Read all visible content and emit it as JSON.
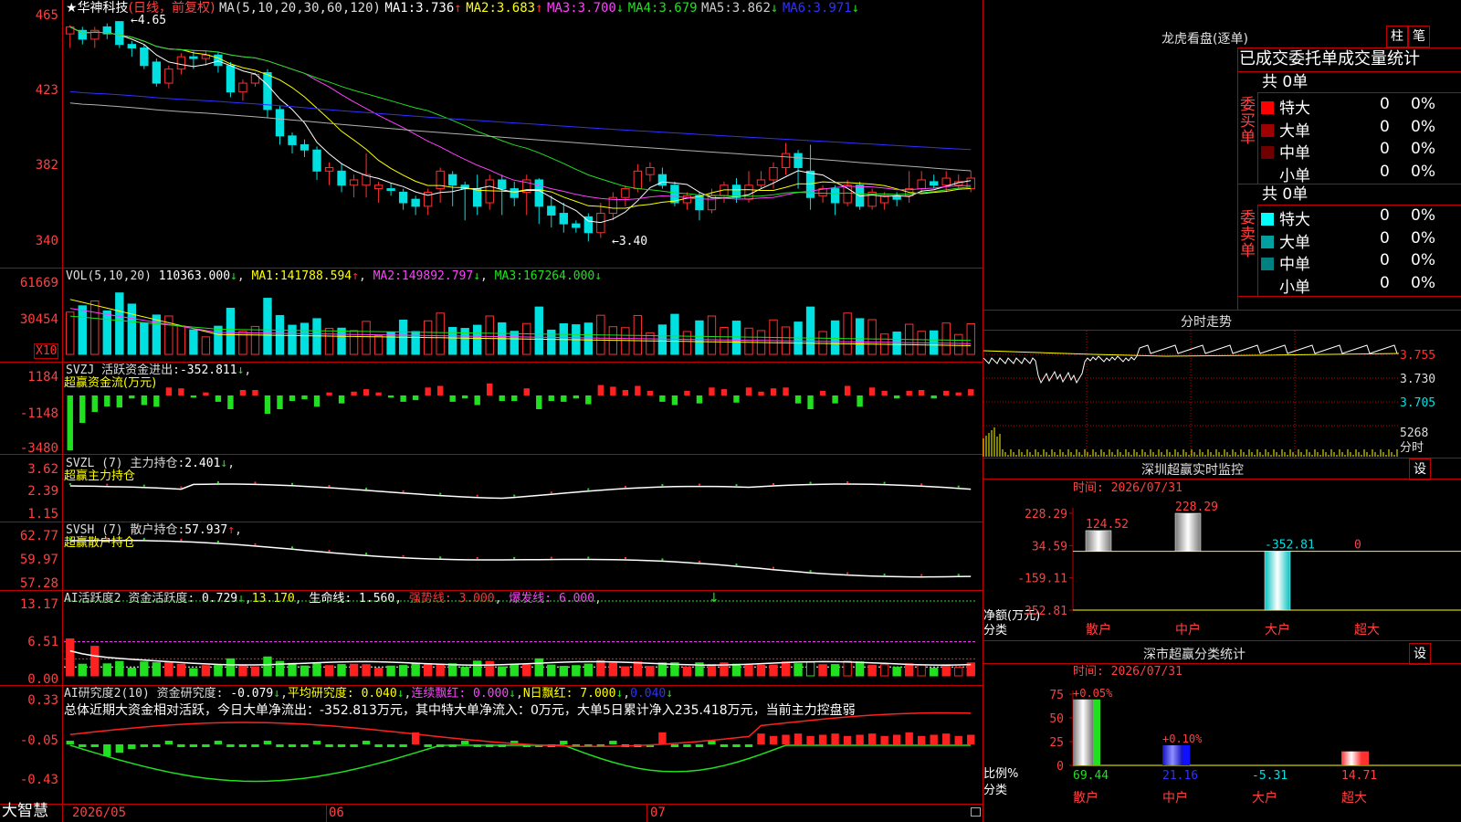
{
  "app": {
    "brand": "大智慧"
  },
  "colors": {
    "up": "#ff3030",
    "down": "#00e0e0",
    "vol_down": "#00e0e0",
    "flow_up": "#ff2020",
    "flow_down": "#20e020",
    "ma1": "#ffffff",
    "ma2": "#ffff00",
    "ma3": "#ff40ff",
    "ma4": "#20e020",
    "ma5": "#b0b0b0",
    "ma6": "#3030ff",
    "grid": "#c00000"
  },
  "main": {
    "star": "★",
    "name": "华神科技",
    "period": "(日线，前复权)",
    "ma_head": "MA(5,10,20,30,60,120)",
    "ma": [
      {
        "label": "MA1:",
        "value": "3.736",
        "arrow": "↑"
      },
      {
        "label": "MA2:",
        "value": "3.683",
        "arrow": "↑"
      },
      {
        "label": "MA3:",
        "value": "3.700",
        "arrow": "↓"
      },
      {
        "label": "MA4:",
        "value": "3.679",
        "arrow": ""
      },
      {
        "label": "MA5:",
        "value": "3.862",
        "arrow": "↓"
      },
      {
        "label": "MA6:",
        "value": "3.971",
        "arrow": "↓"
      }
    ],
    "y_labels": [
      "465",
      "423",
      "382",
      "340"
    ],
    "hi_mark": "4.65",
    "lo_mark": "←3.40",
    "candles": [
      [
        4.58,
        4.62,
        4.5,
        4.63
      ],
      [
        4.6,
        4.55,
        4.52,
        4.62
      ],
      [
        4.55,
        4.6,
        4.5,
        4.62
      ],
      [
        4.62,
        4.58,
        4.55,
        4.64
      ],
      [
        4.65,
        4.52,
        4.5,
        4.65
      ],
      [
        4.52,
        4.5,
        4.45,
        4.54
      ],
      [
        4.5,
        4.4,
        4.38,
        4.52
      ],
      [
        4.42,
        4.3,
        4.28,
        4.44
      ],
      [
        4.3,
        4.38,
        4.27,
        4.4
      ],
      [
        4.38,
        4.45,
        4.35,
        4.47
      ],
      [
        4.45,
        4.44,
        4.38,
        4.48
      ],
      [
        4.44,
        4.46,
        4.4,
        4.48
      ],
      [
        4.46,
        4.4,
        4.36,
        4.48
      ],
      [
        4.4,
        4.25,
        4.22,
        4.42
      ],
      [
        4.25,
        4.3,
        4.2,
        4.32
      ],
      [
        4.3,
        4.35,
        4.28,
        4.36
      ],
      [
        4.36,
        4.15,
        4.1,
        4.38
      ],
      [
        4.15,
        4.0,
        3.95,
        4.17
      ],
      [
        4.0,
        3.95,
        3.9,
        4.02
      ],
      [
        3.95,
        3.92,
        3.88,
        3.98
      ],
      [
        3.92,
        3.8,
        3.75,
        3.94
      ],
      [
        3.8,
        3.82,
        3.72,
        3.85
      ],
      [
        3.8,
        3.72,
        3.68,
        3.84
      ],
      [
        3.72,
        3.75,
        3.65,
        3.78
      ],
      [
        3.72,
        3.78,
        3.65,
        3.9
      ],
      [
        3.7,
        3.72,
        3.62,
        3.74
      ],
      [
        3.7,
        3.69,
        3.66,
        3.73
      ],
      [
        3.68,
        3.62,
        3.58,
        3.7
      ],
      [
        3.64,
        3.6,
        3.55,
        3.66
      ],
      [
        3.6,
        3.68,
        3.55,
        3.7
      ],
      [
        3.7,
        3.8,
        3.62,
        3.82
      ],
      [
        3.78,
        3.72,
        3.6,
        3.8
      ],
      [
        3.72,
        3.7,
        3.52,
        3.74
      ],
      [
        3.7,
        3.6,
        3.55,
        3.78
      ],
      [
        3.62,
        3.75,
        3.58,
        3.78
      ],
      [
        3.75,
        3.7,
        3.55,
        3.78
      ],
      [
        3.7,
        3.65,
        3.6,
        3.74
      ],
      [
        3.68,
        3.75,
        3.55,
        3.78
      ],
      [
        3.75,
        3.6,
        3.5,
        3.76
      ],
      [
        3.6,
        3.55,
        3.48,
        3.66
      ],
      [
        3.56,
        3.5,
        3.45,
        3.62
      ],
      [
        3.5,
        3.48,
        3.45,
        3.52
      ],
      [
        3.54,
        3.45,
        3.4,
        3.56
      ],
      [
        3.45,
        3.56,
        3.42,
        3.62
      ],
      [
        3.56,
        3.65,
        3.52,
        3.68
      ],
      [
        3.65,
        3.7,
        3.6,
        3.72
      ],
      [
        3.7,
        3.8,
        3.68,
        3.84
      ],
      [
        3.78,
        3.82,
        3.74,
        3.85
      ],
      [
        3.78,
        3.72,
        3.7,
        3.82
      ],
      [
        3.72,
        3.62,
        3.6,
        3.74
      ],
      [
        3.62,
        3.66,
        3.58,
        3.68
      ],
      [
        3.66,
        3.58,
        3.52,
        3.68
      ],
      [
        3.58,
        3.66,
        3.56,
        3.7
      ],
      [
        3.66,
        3.72,
        3.62,
        3.74
      ],
      [
        3.72,
        3.65,
        3.62,
        3.76
      ],
      [
        3.64,
        3.72,
        3.62,
        3.8
      ],
      [
        3.72,
        3.75,
        3.7,
        3.8
      ],
      [
        3.75,
        3.82,
        3.7,
        3.85
      ],
      [
        3.82,
        3.9,
        3.78,
        3.96
      ],
      [
        3.9,
        3.82,
        3.7,
        3.92
      ],
      [
        3.8,
        3.65,
        3.58,
        3.95
      ],
      [
        3.66,
        3.7,
        3.62,
        3.72
      ],
      [
        3.7,
        3.62,
        3.55,
        3.72
      ],
      [
        3.62,
        3.72,
        3.6,
        3.75
      ],
      [
        3.72,
        3.6,
        3.58,
        3.74
      ],
      [
        3.6,
        3.68,
        3.58,
        3.7
      ],
      [
        3.62,
        3.66,
        3.58,
        3.68
      ],
      [
        3.66,
        3.64,
        3.6,
        3.68
      ],
      [
        3.66,
        3.7,
        3.62,
        3.8
      ],
      [
        3.7,
        3.75,
        3.68,
        3.8
      ],
      [
        3.74,
        3.72,
        3.7,
        3.78
      ],
      [
        3.72,
        3.76,
        3.68,
        3.8
      ],
      [
        3.72,
        3.74,
        3.7,
        3.78
      ],
      [
        3.7,
        3.76,
        3.68,
        3.8
      ]
    ]
  },
  "vol": {
    "head": "VOL(5,10,20)",
    "value": "110363.000",
    "arrow": "↓",
    "ma": [
      {
        "label": "MA1:",
        "value": "141788.594",
        "arrow": "↑"
      },
      {
        "label": "MA2:",
        "value": "149892.797",
        "arrow": "↓"
      },
      {
        "label": "MA3:",
        "value": "167264.000",
        "arrow": "↓"
      }
    ],
    "y_labels": [
      "61669",
      "30454"
    ],
    "unit": "X10"
  },
  "svzj": {
    "head": "SVZJ",
    "label": "活跃资金进出:",
    "value": "-352.811",
    "arrow": "↓",
    "sub": "超赢资金流(万元)",
    "y_labels": [
      "1184",
      "-1148",
      "-3480"
    ]
  },
  "svzl": {
    "head": "SVZL (7)",
    "label": "主力持仓:",
    "value": "2.401",
    "arrow": "↓",
    "sub": "超赢主力持仓",
    "y_labels": [
      "3.62",
      "2.39",
      "1.15"
    ]
  },
  "svsh": {
    "head": "SVSH (7)",
    "label": "散户持仓:",
    "value": "57.937",
    "arrow": "↑",
    "sub": "超赢散户持仓",
    "y_labels": [
      "62.77",
      "59.97",
      "57.28"
    ]
  },
  "ai_active": {
    "head": "AI活跃度2",
    "label": "资金活跃度:",
    "value": "0.729",
    "arrow": "↓",
    "v2": "13.170",
    "life_label": "生命线:",
    "life": "1.560",
    "strong_label": "强势线:",
    "strong": "3.000",
    "burst_label": "爆发线:",
    "burst": "6.000",
    "down_mark": "↓",
    "y_labels": [
      "13.17",
      "6.51",
      "0.00"
    ]
  },
  "ai_research": {
    "head": "AI研究度2(10)",
    "label": "资金研究度:",
    "value": "-0.079",
    "arrow": "↓",
    "avg_label": "平均研究度:",
    "avg": "0.040",
    "avg_arrow": "↓",
    "cont_label": "连续飘红:",
    "cont": "0.000",
    "cont_arrow": "↓",
    "n_label": "N日飘红:",
    "n": "7.000",
    "n_arrow": "↓",
    "n2": "0.040",
    "n2_arrow": "↓",
    "summary": "总体近期大资金相对活跃，今日大单净流出：-352.813万元，其中特大单净流入：0万元，大单5日累计净入235.418万元，当前主力控盘弱",
    "y_labels": [
      "0.33",
      "-0.05",
      "-0.43"
    ]
  },
  "xaxis": {
    "labels": [
      "2026/05",
      "06",
      "07"
    ]
  },
  "dragon": {
    "title": "龙虎看盘(逐单)",
    "btn_bar": "柱",
    "btn_pen": "笔",
    "header": "已成交委托单成交量统计",
    "buy": {
      "total": "共 0单",
      "side": "委买单",
      "rows": [
        {
          "name": "特大",
          "v": "0",
          "p": "0%",
          "c": "#ff0000"
        },
        {
          "name": "大单",
          "v": "0",
          "p": "0%",
          "c": "#a00000"
        },
        {
          "name": "中单",
          "v": "0",
          "p": "0%",
          "c": "#700000"
        },
        {
          "name": "小单",
          "v": "0",
          "p": "0%",
          "c": "#000000"
        }
      ]
    },
    "sell": {
      "total": "共 0单",
      "side": "委卖单",
      "rows": [
        {
          "name": "特大",
          "v": "0",
          "p": "0%",
          "c": "#00ffff"
        },
        {
          "name": "大单",
          "v": "0",
          "p": "0%",
          "c": "#00a0a0"
        },
        {
          "name": "中单",
          "v": "0",
          "p": "0%",
          "c": "#008080"
        },
        {
          "name": "小单",
          "v": "0",
          "p": "0%",
          "c": "#000000"
        }
      ]
    }
  },
  "intraday": {
    "title": "分时走势",
    "y_labels": [
      "3.755",
      "3.730",
      "3.705"
    ],
    "vol_label": "5268",
    "vol_unit": "分时"
  },
  "sz_monitor": {
    "title": "深圳超赢实时监控",
    "btn": "设",
    "time": "时间: 2026/07/31",
    "y_labels": [
      "228.29",
      "34.59",
      "-159.11",
      "-352.81"
    ],
    "y_title": "净额(万元)",
    "x_title": "分类",
    "categories": [
      "散户",
      "中户",
      "大户",
      "超大"
    ],
    "values": [
      124.52,
      228.29,
      -352.81,
      0
    ],
    "value_labels": [
      "124.52",
      "228.29",
      "-352.81",
      "0"
    ]
  },
  "sz_class": {
    "title": "深市超赢分类统计",
    "btn": "设",
    "time": "时间: 2026/07/31",
    "y_labels": [
      "75",
      "50",
      "25",
      "0"
    ],
    "y_title": "比例%",
    "x_title": "分类",
    "categories": [
      "散户",
      "中户",
      "大户",
      "超大"
    ],
    "top_labels": [
      "+0.05%",
      "+0.10%",
      "",
      ""
    ],
    "bottom_labels": [
      "69.44",
      "21.16",
      "-5.31",
      "14.71"
    ],
    "values": [
      69.44,
      21.16,
      -5.31,
      14.71
    ]
  }
}
